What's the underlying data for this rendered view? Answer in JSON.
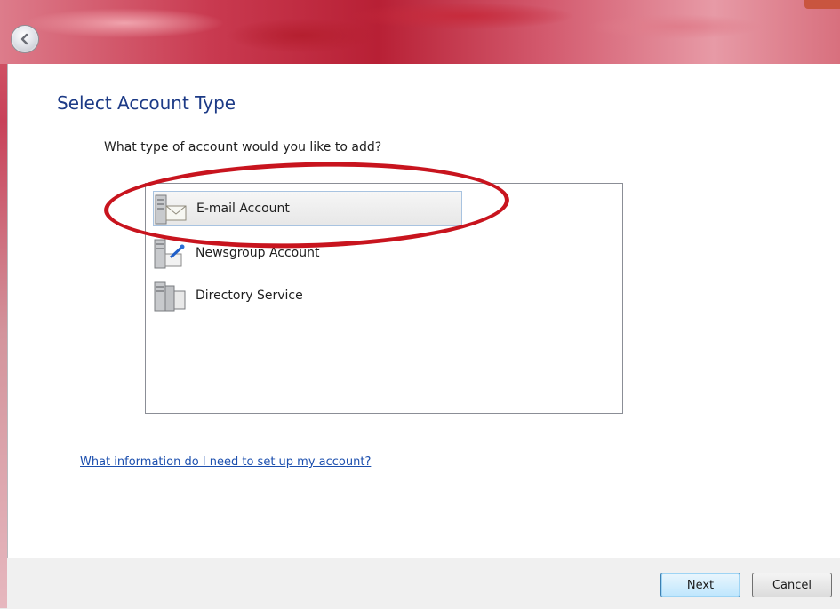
{
  "window": {
    "page_title": "Select Account Type",
    "question": "What type of account would you like to add?"
  },
  "account_types": [
    {
      "label": "E-mail Account",
      "icon": "email-server-icon",
      "selected": true
    },
    {
      "label": "Newsgroup Account",
      "icon": "newsgroup-server-icon",
      "selected": false
    },
    {
      "label": "Directory Service",
      "icon": "directory-server-icon",
      "selected": false
    }
  ],
  "help_link": "What information do I need to set up my account?",
  "buttons": {
    "next": "Next",
    "cancel": "Cancel"
  },
  "colors": {
    "title_blue": "#1c3a86",
    "link_blue": "#1c4fae",
    "annotation_red": "#c8141e"
  }
}
